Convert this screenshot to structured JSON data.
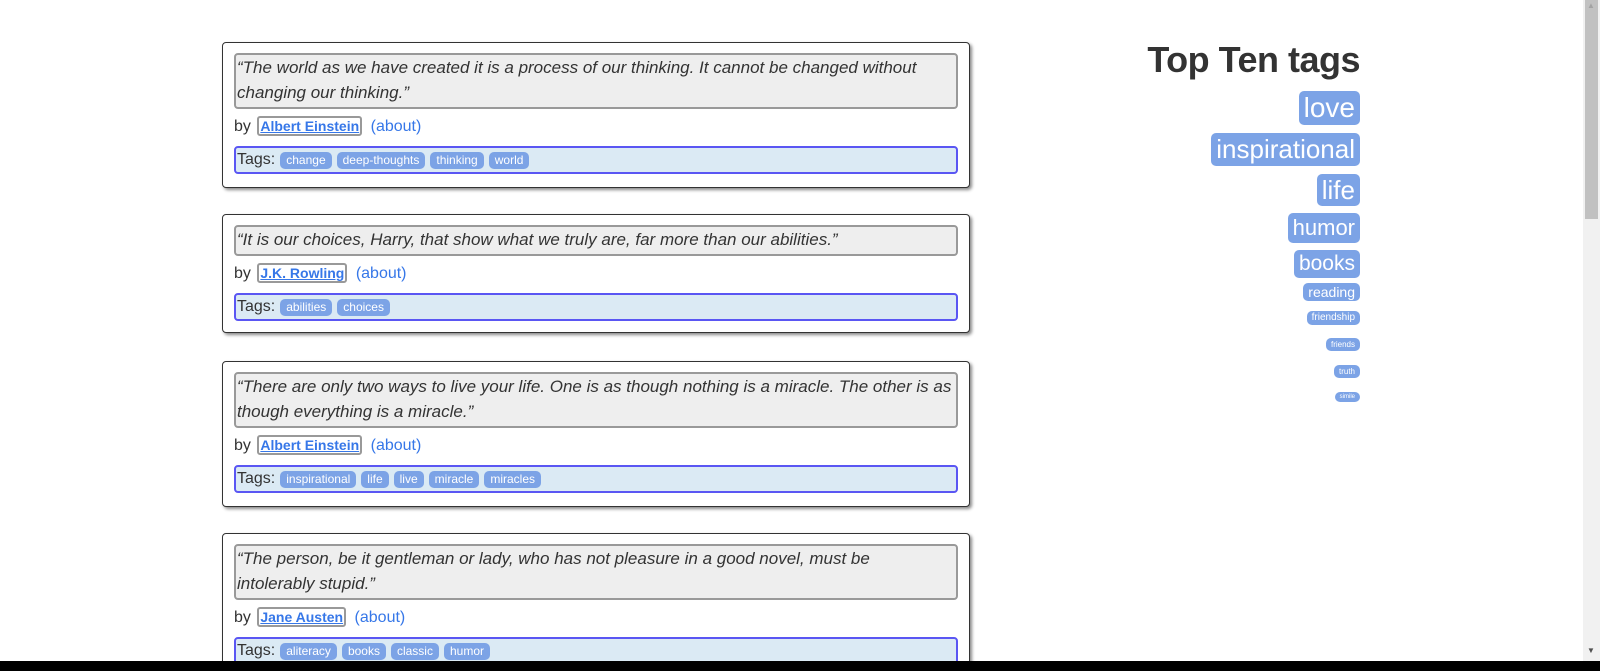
{
  "quotes": [
    {
      "text": "“The world as we have created it is a process of our thinking. It cannot be changed without changing our thinking.”",
      "by": "by",
      "author": "Albert Einstein",
      "about": "(about)",
      "tags_label": "Tags:",
      "tags": [
        "change",
        "deep-thoughts",
        "thinking",
        "world"
      ]
    },
    {
      "text": "“It is our choices, Harry, that show what we truly are, far more than our abilities.”",
      "by": "by",
      "author": "J.K. Rowling",
      "about": "(about)",
      "tags_label": "Tags:",
      "tags": [
        "abilities",
        "choices"
      ]
    },
    {
      "text": "“There are only two ways to live your life. One is as though nothing is a miracle. The other is as though everything is a miracle.”",
      "by": "by",
      "author": "Albert Einstein",
      "about": "(about)",
      "tags_label": "Tags:",
      "tags": [
        "inspirational",
        "life",
        "live",
        "miracle",
        "miracles"
      ]
    },
    {
      "text": "“The person, be it gentleman or lady, who has not pleasure in a good novel, must be intolerably stupid.”",
      "by": "by",
      "author": "Jane Austen",
      "about": "(about)",
      "tags_label": "Tags:",
      "tags": [
        "aliteracy",
        "books",
        "classic",
        "humor"
      ]
    }
  ],
  "sidebar": {
    "title": "Top Ten tags",
    "tags": [
      "love",
      "inspirational",
      "life",
      "humor",
      "books",
      "reading",
      "friendship",
      "friends",
      "truth",
      "simile"
    ]
  },
  "colors": {
    "link": "#3677e8",
    "tag_bg": "#7ca3e6",
    "tags_border": "#5a56f3",
    "tags_bg": "#dbeaf4"
  },
  "scrollbar_position": 0
}
